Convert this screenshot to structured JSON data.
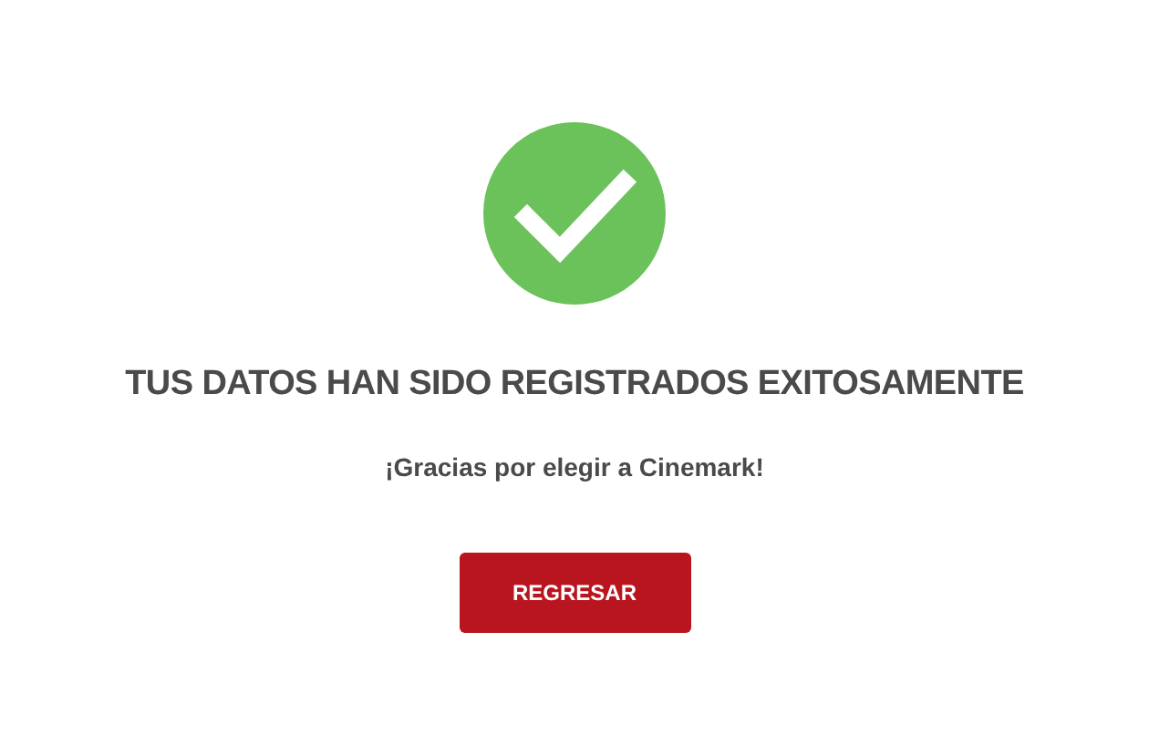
{
  "heading": "TUS DATOS HAN SIDO REGISTRADOS EXITOSAMENTE",
  "message": "¡Gracias por elegir a Cinemark!",
  "button": "REGRESAR"
}
